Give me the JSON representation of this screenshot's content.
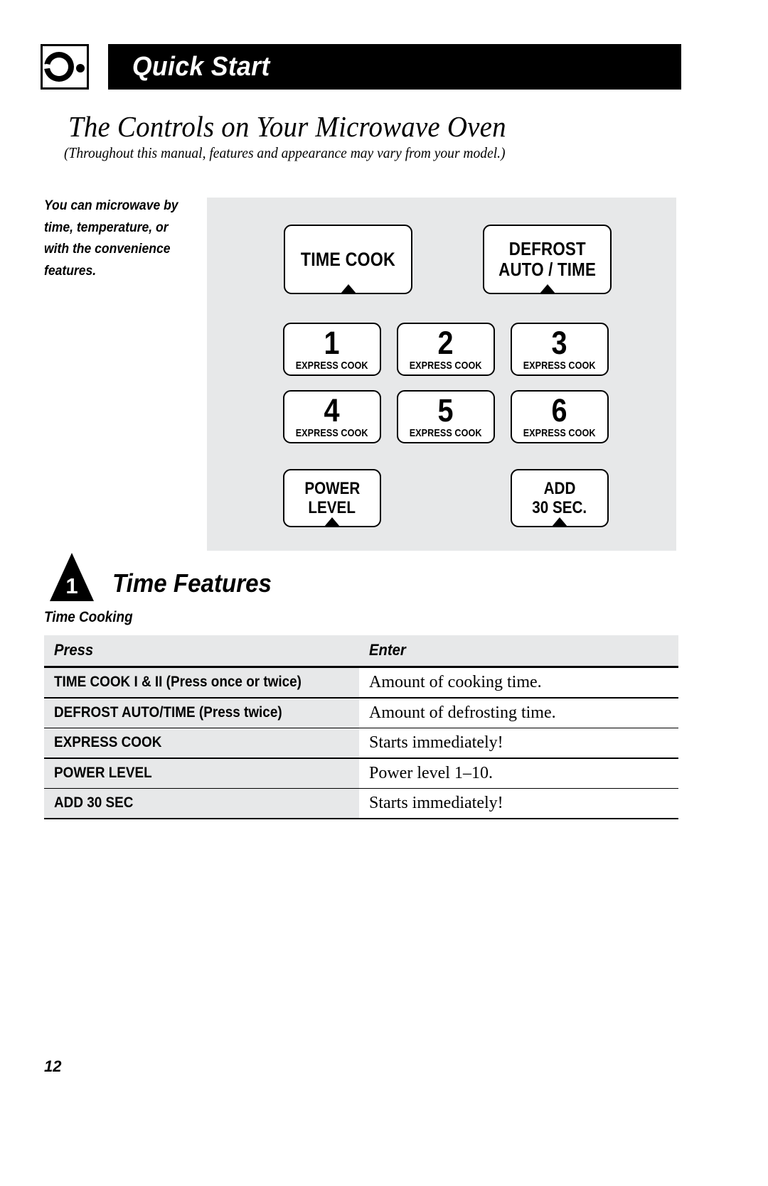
{
  "header": {
    "chapter_label": "Quick Start",
    "icon": "microwave-dial-icon"
  },
  "page": {
    "title": "The Controls on Your Microwave Oven",
    "subtitle": "(Throughout this manual, features and appearance may vary from your model.)",
    "number": "12"
  },
  "margin_note": {
    "text": "You can microwave by time, temperature, or with the convenience features."
  },
  "control_panel": {
    "buttons": [
      {
        "id": "time-cook",
        "label": "TIME COOK",
        "label2": "",
        "sublabel": ""
      },
      {
        "id": "defrost",
        "label": "DEFROST",
        "label2": "AUTO / TIME",
        "sublabel": ""
      },
      {
        "id": "express-1",
        "digit": "1",
        "sublabel": "EXPRESS COOK"
      },
      {
        "id": "express-2",
        "digit": "2",
        "sublabel": "EXPRESS COOK"
      },
      {
        "id": "express-3",
        "digit": "3",
        "sublabel": "EXPRESS COOK"
      },
      {
        "id": "express-4",
        "digit": "4",
        "sublabel": "EXPRESS COOK"
      },
      {
        "id": "express-5",
        "digit": "5",
        "sublabel": "EXPRESS COOK"
      },
      {
        "id": "express-6",
        "digit": "6",
        "sublabel": "EXPRESS COOK"
      },
      {
        "id": "power-level",
        "label": "POWER",
        "label2": "LEVEL"
      },
      {
        "id": "add-30-sec",
        "label": "ADD",
        "label2": "30 SEC."
      }
    ],
    "time_cook_label": "TIME COOK",
    "defrost_line1": "DEFROST",
    "defrost_line2": "AUTO / TIME",
    "express_cook_label": "EXPRESS COOK",
    "digits": {
      "d1": "1",
      "d2": "2",
      "d3": "3",
      "d4": "4",
      "d5": "5",
      "d6": "6"
    },
    "power_line1": "POWER",
    "power_line2": "LEVEL",
    "add_line1": "ADD",
    "add_line2": "30 SEC.",
    "background_color": "#e7e8e9"
  },
  "section": {
    "number": "1",
    "title": "Time Features",
    "subsection": "Time Cooking"
  },
  "table": {
    "headers": {
      "press": "Press",
      "enter": "Enter"
    },
    "rows": [
      {
        "press": "TIME COOK I & II (Press once or twice)",
        "enter": "Amount of cooking time."
      },
      {
        "press": "DEFROST AUTO/TIME (Press twice)",
        "enter": "Amount of defrosting time."
      },
      {
        "press": "EXPRESS COOK",
        "enter": "Starts immediately!"
      },
      {
        "press": "POWER LEVEL",
        "enter": "Power level 1–10."
      },
      {
        "press": "ADD 30 SEC",
        "enter": "Starts immediately!"
      }
    ]
  }
}
